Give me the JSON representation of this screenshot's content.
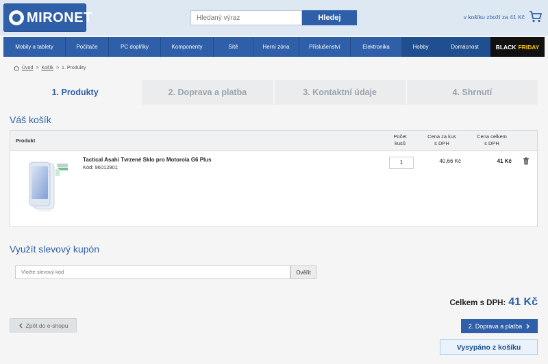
{
  "header": {
    "logo_text": "MIRONET",
    "search_placeholder": "Hledaný výraz",
    "search_button": "Hledej",
    "cart_summary": "v košíku zboží za 41 Kč",
    "cart_icon": "cart-icon"
  },
  "nav": {
    "items": [
      {
        "label": "Mobily a tablety"
      },
      {
        "label": "Počítače"
      },
      {
        "label": "PC doplňky"
      },
      {
        "label": "Komponenty"
      },
      {
        "label": "Sítě"
      },
      {
        "label": "Herní zóna"
      },
      {
        "label": "Příslušenství"
      },
      {
        "label": "Elektronika"
      },
      {
        "label": "Hobby"
      },
      {
        "label": "Domácnost"
      }
    ],
    "black_friday": {
      "black": "BLACK",
      "friday": "FRIDAY"
    }
  },
  "breadcrumb": {
    "home": "Úvod",
    "cart": "Košík",
    "current": "1. Produkty",
    "separator": ">"
  },
  "steps": [
    {
      "label": "1. Produkty",
      "active": true
    },
    {
      "label": "2. Doprava a platba",
      "active": false
    },
    {
      "label": "3. Kontaktní údaje",
      "active": false
    },
    {
      "label": "4. Shrnutí",
      "active": false
    }
  ],
  "cart": {
    "title": "Váš košík",
    "columns": {
      "product": "Produkt",
      "qty_line1": "Počet",
      "qty_line2": "kusů",
      "unit_line1": "Cena za kus",
      "unit_line2": "s DPH",
      "total_line1": "Cena celkem",
      "total_line2": "s DPH"
    },
    "items": [
      {
        "name": "Tactical Asahi Tvrzené Sklo pro Motorola G6 Plus",
        "code": "Kód: 96012901",
        "qty": "1",
        "unit_price": "40,66 Kč",
        "total_price": "41 Kč"
      }
    ]
  },
  "coupon": {
    "title": "Využít slevový kupón",
    "placeholder": "Vložte slevový kód",
    "button": "Ověřit"
  },
  "summary": {
    "label": "Celkem s DPH:",
    "value": "41 Kč"
  },
  "actions": {
    "back": "Zpět do e-shopu",
    "next": "2. Doprava a platba",
    "empty": "Vysypáno z košíku"
  },
  "colors": {
    "brand": "#2e5fa8",
    "header_bg": "#dde8f2",
    "black_friday_accent": "#f6c200"
  }
}
